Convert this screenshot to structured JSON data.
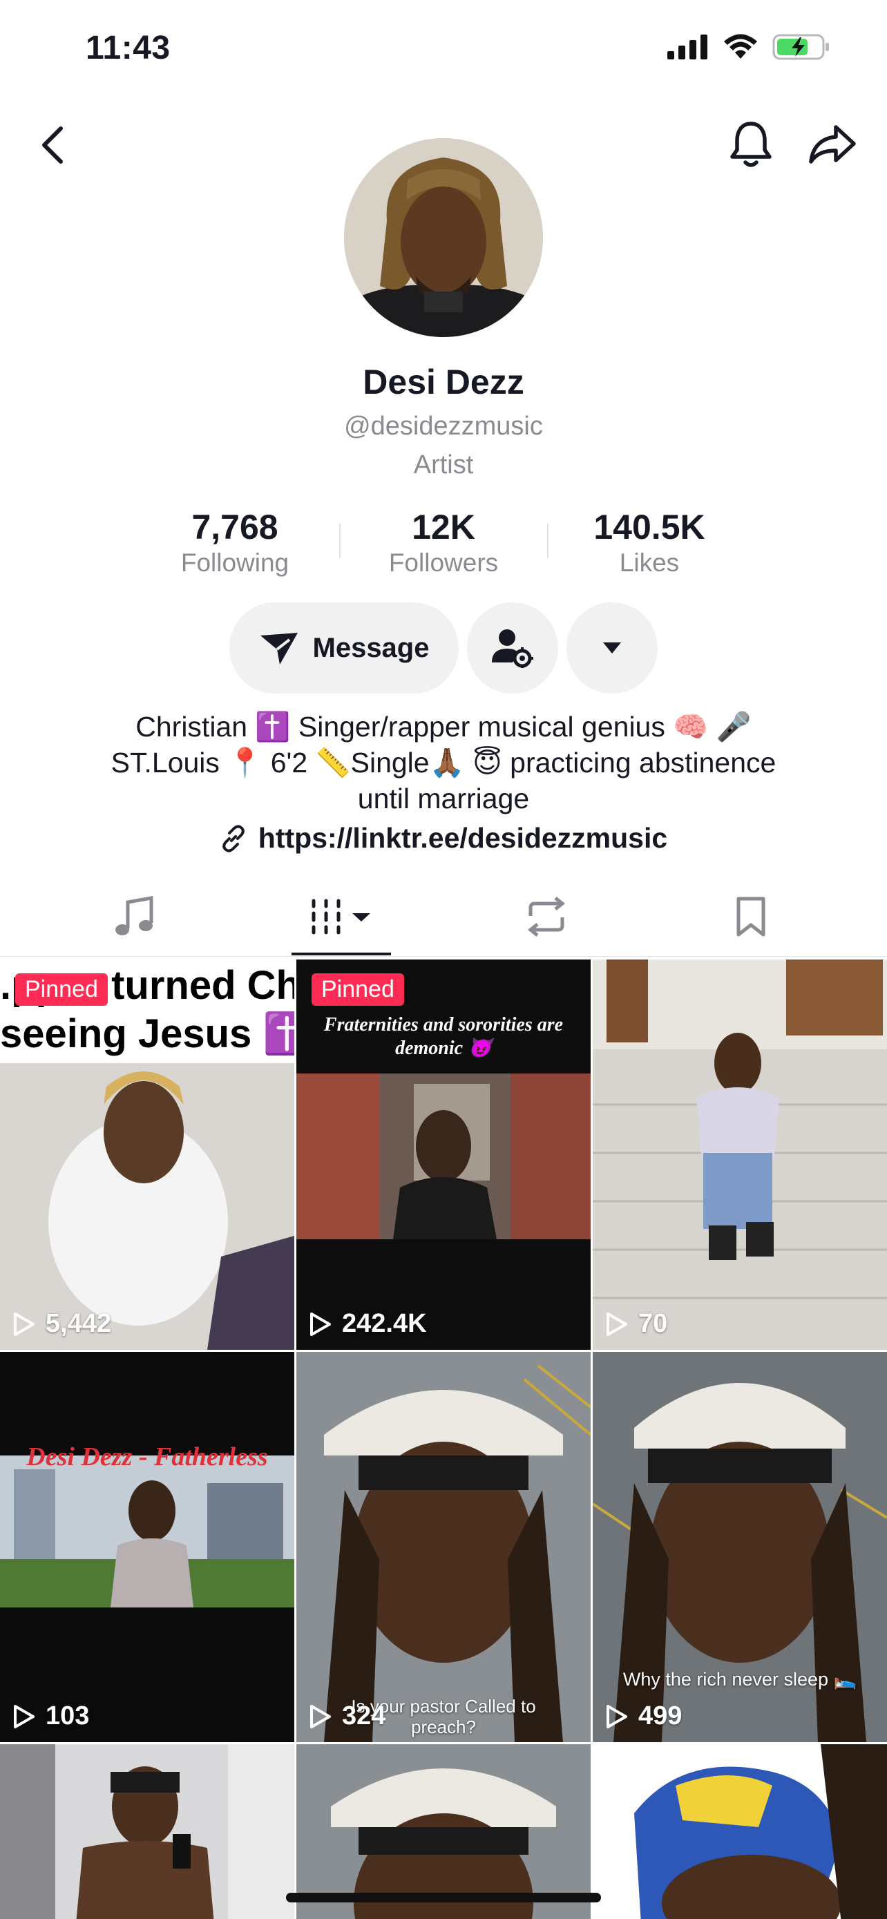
{
  "status_bar": {
    "time": "11:43"
  },
  "profile": {
    "display_name": "Desi Dezz",
    "username": "@desidezzmusic",
    "category": "Artist"
  },
  "stats": [
    {
      "value": "7,768",
      "label": "Following"
    },
    {
      "value": "12K",
      "label": "Followers"
    },
    {
      "value": "140.5K",
      "label": "Likes"
    }
  ],
  "actions": {
    "message_label": "Message"
  },
  "bio": {
    "lines": [
      "Christian ✝️ Singer/rapper musical genius 🧠 🎤",
      "ST.Louis 📍 6'2 📏Single🙏🏾 😇 practicing abstinence",
      "until marriage"
    ],
    "link": "https://linktr.ee/desidezzmusic"
  },
  "tabs": [
    "music-tab",
    "videos-tab",
    "reposts-tab",
    "favorites-tab"
  ],
  "videos": [
    {
      "pinned": "Pinned",
      "views": "5,442",
      "overlay": "...per turned Ch\nseeing Jesus ✝️"
    },
    {
      "pinned": "Pinned",
      "views": "242.4K",
      "overlay": "Fraternities and sororities are demonic 😈"
    },
    {
      "pinned": "",
      "views": "70",
      "overlay": ""
    },
    {
      "pinned": "",
      "views": "103",
      "overlay": "Desi Dezz - Fatherless"
    },
    {
      "pinned": "",
      "views": "324",
      "overlay": "Is your pastor Called to preach?"
    },
    {
      "pinned": "",
      "views": "499",
      "overlay": "Why the rich never sleep 🛌"
    }
  ],
  "colors": {
    "accent": "#fe2c55",
    "text": "#161823",
    "muted": "#8a8b91",
    "button_bg": "#f1f1f2",
    "battery": "#4cd964"
  }
}
